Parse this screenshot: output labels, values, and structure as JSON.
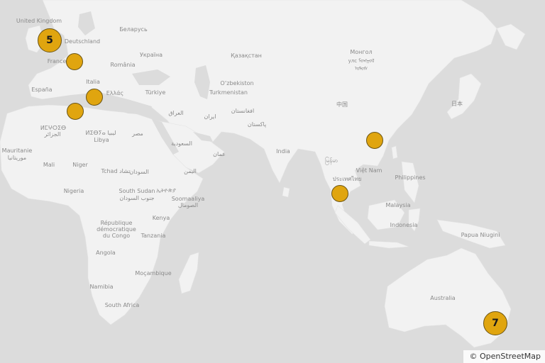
{
  "map": {
    "water_color": "#dcdcdc",
    "land_color": "#f2f2f2",
    "marker_color": "#e0a50f",
    "attribution": "© OpenStreetMap"
  },
  "labels": [
    {
      "id": "uk",
      "text": "United Kingdom"
    },
    {
      "id": "de",
      "text": "Deutschland"
    },
    {
      "id": "by",
      "text": "Беларусь"
    },
    {
      "id": "ua",
      "text": "Україна"
    },
    {
      "id": "kz",
      "text": "Қазақстан"
    },
    {
      "id": "mn1",
      "text": "Монгол"
    },
    {
      "id": "mn2",
      "text": "улс ᠮᠣᠩᠭᠣᠯ"
    },
    {
      "id": "mn3",
      "text": "ᠤᠯᠤᠰ"
    },
    {
      "id": "fr",
      "text": "France"
    },
    {
      "id": "ro",
      "text": "România"
    },
    {
      "id": "it",
      "text": "Italia"
    },
    {
      "id": "uz",
      "text": "O‘zbekiston"
    },
    {
      "id": "es",
      "text": "España"
    },
    {
      "id": "gr",
      "text": "Ελλάς"
    },
    {
      "id": "tr",
      "text": "Türkiye"
    },
    {
      "id": "tm",
      "text": "Turkmenistan"
    },
    {
      "id": "cn",
      "text": "中国"
    },
    {
      "id": "jp",
      "text": "日本"
    },
    {
      "id": "iq",
      "text": "العراق"
    },
    {
      "id": "af",
      "text": "افغانستان"
    },
    {
      "id": "ir",
      "text": "ایران"
    },
    {
      "id": "ma1",
      "text": "ⵍⵎⵖⵔⵉⴱ"
    },
    {
      "id": "dz",
      "text": "الجزائر"
    },
    {
      "id": "ly1",
      "text": "ⵍⵉⴱⵢⴰ ليبيا"
    },
    {
      "id": "ly2",
      "text": "Libya"
    },
    {
      "id": "eg",
      "text": "مصر"
    },
    {
      "id": "pk",
      "text": "پاکستان"
    },
    {
      "id": "sa",
      "text": "السعودية"
    },
    {
      "id": "om",
      "text": "عمان"
    },
    {
      "id": "in",
      "text": "India"
    },
    {
      "id": "mm",
      "text": "မြန်မာ"
    },
    {
      "id": "mr1",
      "text": "Mauritanie"
    },
    {
      "id": "mr2",
      "text": "موريتانيا"
    },
    {
      "id": "ml",
      "text": "Mali"
    },
    {
      "id": "ne",
      "text": "Niger"
    },
    {
      "id": "td",
      "text": "Tchad تشاد"
    },
    {
      "id": "sd",
      "text": "السودان"
    },
    {
      "id": "ye",
      "text": "اليمن"
    },
    {
      "id": "vn",
      "text": "Việt Nam"
    },
    {
      "id": "th",
      "text": "ประเทศไทย"
    },
    {
      "id": "ph",
      "text": "Philippines"
    },
    {
      "id": "ng",
      "text": "Nigeria"
    },
    {
      "id": "ss1",
      "text": "South Sudan"
    },
    {
      "id": "ss2",
      "text": "جنوب السودان"
    },
    {
      "id": "et",
      "text": "ኢትዮጵያ"
    },
    {
      "id": "so1",
      "text": "Soomaaliya"
    },
    {
      "id": "so2",
      "text": "الصومال"
    },
    {
      "id": "my",
      "text": "Malaysia"
    },
    {
      "id": "cd1",
      "text": "République"
    },
    {
      "id": "cd2",
      "text": "démocratique"
    },
    {
      "id": "cd3",
      "text": "du Congo"
    },
    {
      "id": "ke",
      "text": "Kenya"
    },
    {
      "id": "idn",
      "text": "Indonesia"
    },
    {
      "id": "pg",
      "text": "Papua Niugini"
    },
    {
      "id": "tz",
      "text": "Tanzania"
    },
    {
      "id": "ao",
      "text": "Angola"
    },
    {
      "id": "mz",
      "text": "Moçambique"
    },
    {
      "id": "na",
      "text": "Namibia"
    },
    {
      "id": "au",
      "text": "Australia"
    },
    {
      "id": "za",
      "text": "South Africa"
    }
  ],
  "markers": [
    {
      "id": "uk-cluster",
      "type": "cluster",
      "count": "5"
    },
    {
      "id": "france",
      "type": "single",
      "count": ""
    },
    {
      "id": "greece",
      "type": "single",
      "count": ""
    },
    {
      "id": "tunisia",
      "type": "single",
      "count": ""
    },
    {
      "id": "china-south",
      "type": "single",
      "count": ""
    },
    {
      "id": "malaysia",
      "type": "single",
      "count": ""
    },
    {
      "id": "australia-cluster",
      "type": "cluster",
      "count": "7"
    }
  ]
}
